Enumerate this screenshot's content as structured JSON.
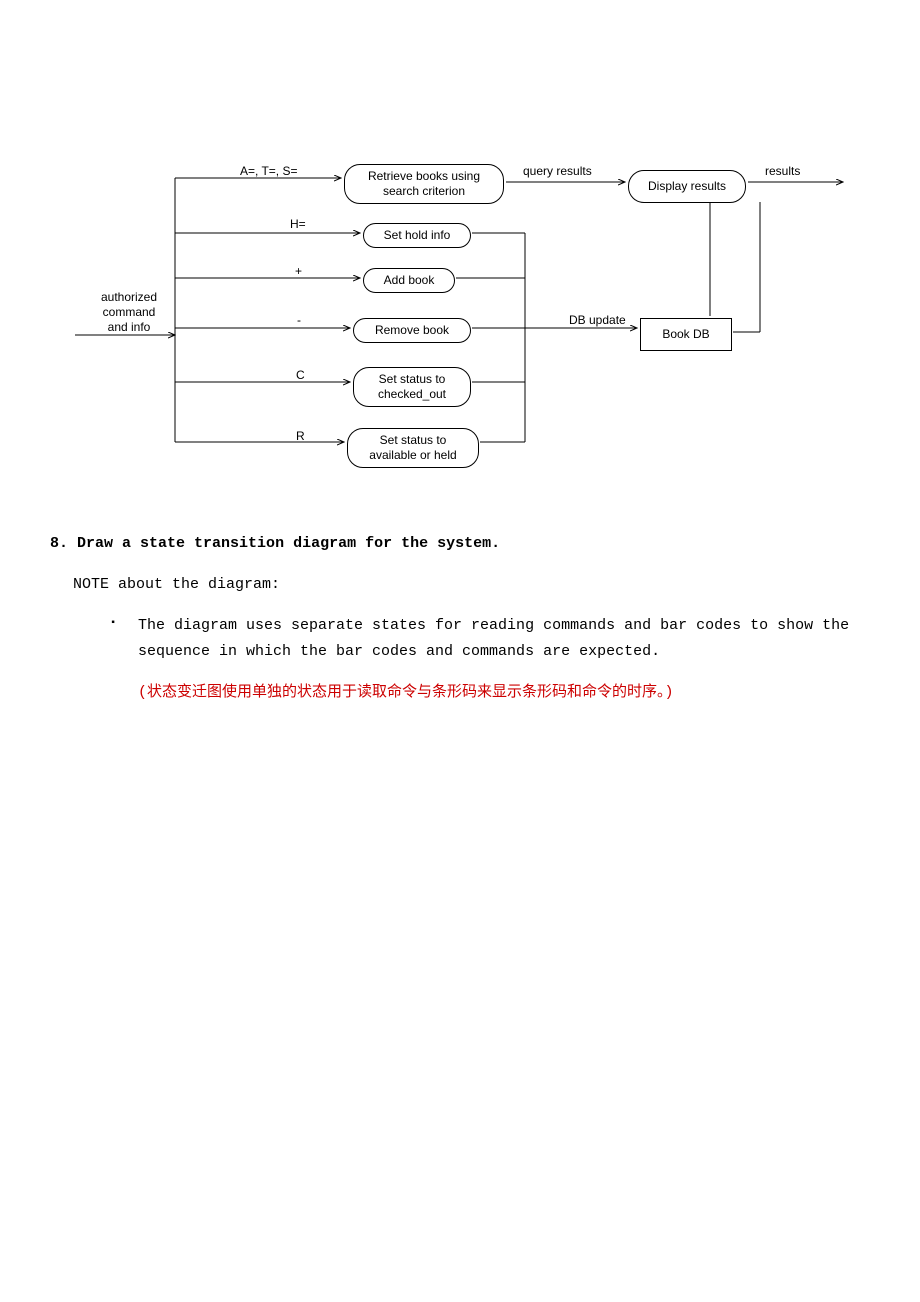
{
  "diagram": {
    "input_left": {
      "label_top": "authorized",
      "label_mid": "command",
      "label_bot": "and info"
    },
    "branches": [
      {
        "label": "A=, T=, S=",
        "bubble": "Retrieve books using\nsearch criterion"
      },
      {
        "label": "H=",
        "bubble": "Set hold info"
      },
      {
        "label": "+",
        "bubble": "Add book"
      },
      {
        "label": "-",
        "bubble": "Remove book"
      },
      {
        "label": "C",
        "bubble": "Set status to\nchecked_out"
      },
      {
        "label": "R",
        "bubble": "Set status to\navailable or held"
      }
    ],
    "query_results_label": "query results",
    "display_bubble": "Display results",
    "results_label": "results",
    "db_update_label": "DB update",
    "book_db_bubble": "Book DB"
  },
  "section8": {
    "number": "8.",
    "heading": "Draw a state transition diagram for the system.",
    "note_intro": "NOTE about the diagram:",
    "bullet1": "The diagram uses separate states for reading commands and bar codes to show the sequence in which the bar codes and commands are expected.",
    "bullet1_cn": "(状态变迁图使用单独的状态用于读取命令与条形码来显示条形码和命令的时序。)"
  }
}
